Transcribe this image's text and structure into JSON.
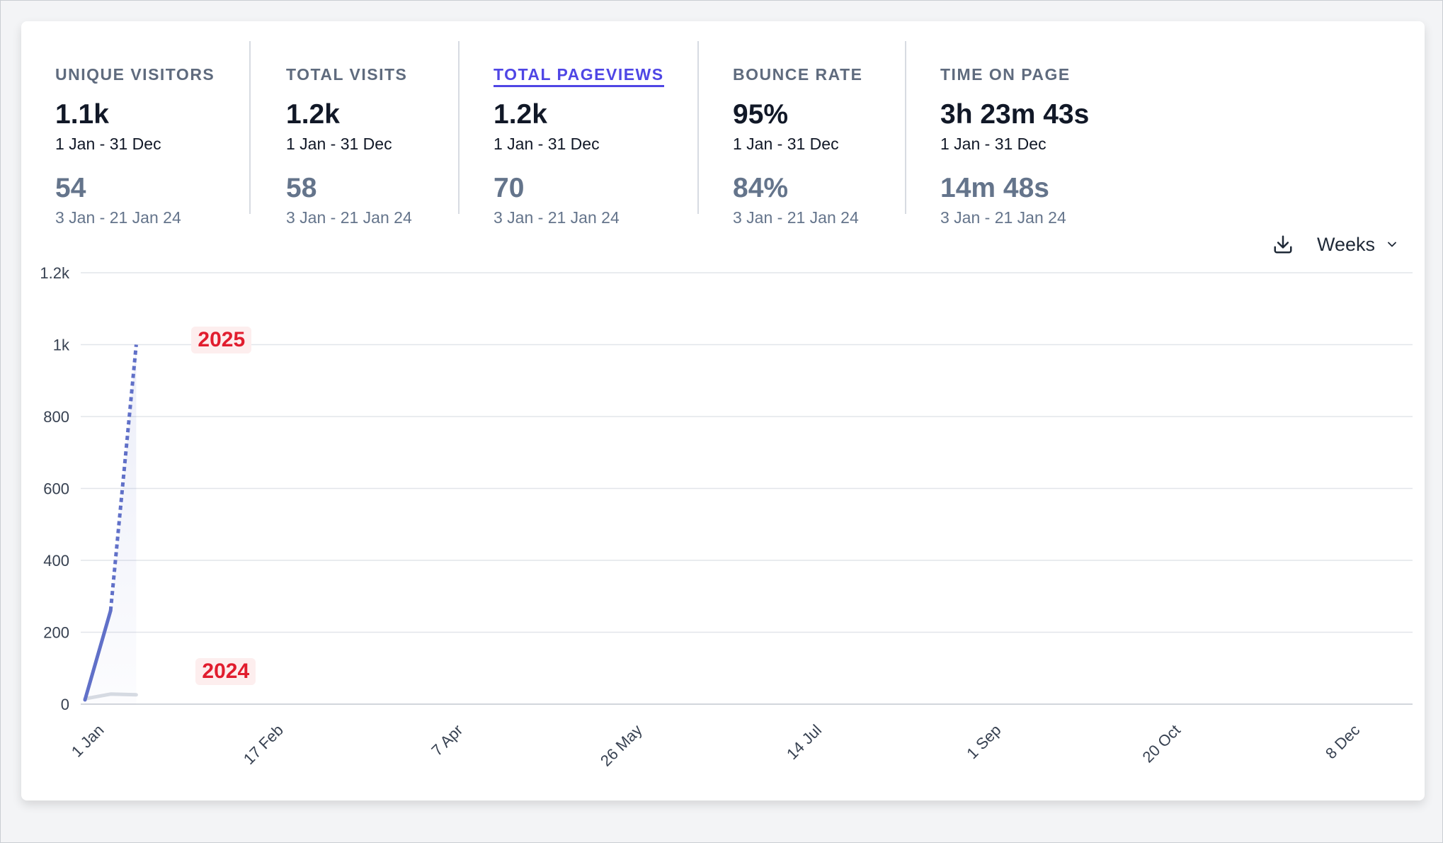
{
  "metrics": [
    {
      "label": "UNIQUE VISITORS",
      "value": "1.1k",
      "range": "1 Jan - 31 Dec",
      "compare_value": "54",
      "compare_range": "3 Jan - 21 Jan 24",
      "active": false
    },
    {
      "label": "TOTAL VISITS",
      "value": "1.2k",
      "range": "1 Jan - 31 Dec",
      "compare_value": "58",
      "compare_range": "3 Jan - 21 Jan 24",
      "active": false
    },
    {
      "label": "TOTAL PAGEVIEWS",
      "value": "1.2k",
      "range": "1 Jan - 31 Dec",
      "compare_value": "70",
      "compare_range": "3 Jan - 21 Jan 24",
      "active": true
    },
    {
      "label": "BOUNCE RATE",
      "value": "95%",
      "range": "1 Jan - 31 Dec",
      "compare_value": "84%",
      "compare_range": "3 Jan - 21 Jan 24",
      "active": false
    },
    {
      "label": "TIME ON PAGE",
      "value": "3h 23m 43s",
      "range": "1 Jan - 31 Dec",
      "compare_value": "14m 48s",
      "compare_range": "3 Jan - 21 Jan 24",
      "active": false
    }
  ],
  "toolbar": {
    "download_icon": "download-icon",
    "interval_label": "Weeks",
    "interval_icon": "chevron-down-icon"
  },
  "colors": {
    "accent": "#4f46e5",
    "series_current": "#6070c8",
    "series_previous": "#d8dce3",
    "year_tag_text": "#e11d2e",
    "year_tag_bg": "#fdeeee"
  },
  "chart_data": {
    "type": "line",
    "ylim": [
      0,
      1200
    ],
    "y_ticks": [
      0,
      200,
      400,
      600,
      800,
      1000,
      1200
    ],
    "y_tick_labels": [
      "0",
      "200",
      "400",
      "600",
      "800",
      "1k",
      "1.2k"
    ],
    "x_tick_labels": [
      "1 Jan",
      "17 Feb",
      "7 Apr",
      "26 May",
      "14 Jul",
      "1 Sep",
      "20 Oct",
      "8 Dec"
    ],
    "x_tick_weeks": [
      0,
      7,
      14,
      21,
      28,
      35,
      42,
      49
    ],
    "x_range_weeks": [
      0,
      52
    ],
    "grid": true,
    "series": [
      {
        "name": "2025",
        "x_weeks": [
          0,
          1,
          2
        ],
        "values": [
          12,
          260,
          1000
        ],
        "solid_until_index": 1,
        "dashed_after": true
      },
      {
        "name": "2024",
        "x_weeks": [
          0,
          1,
          2
        ],
        "values": [
          15,
          28,
          26
        ]
      }
    ]
  }
}
